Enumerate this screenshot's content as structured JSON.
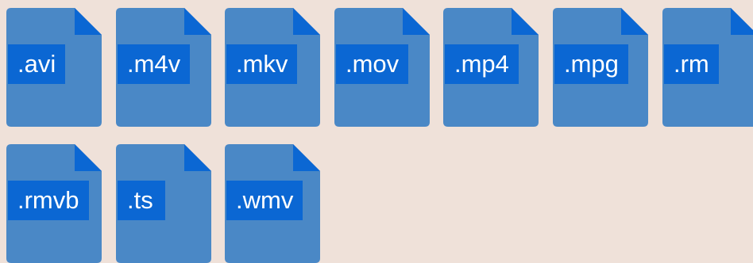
{
  "colors": {
    "background": "#efe1d9",
    "file_body": "#4a88c6",
    "file_fold": "#0b67d3",
    "label_bg": "#0b67d3",
    "label_text": "#ffffff"
  },
  "files": [
    {
      "ext": ".avi",
      "icon": "file-icon"
    },
    {
      "ext": ".m4v",
      "icon": "file-icon"
    },
    {
      "ext": ".mkv",
      "icon": "file-icon"
    },
    {
      "ext": ".mov",
      "icon": "file-icon"
    },
    {
      "ext": ".mp4",
      "icon": "file-icon"
    },
    {
      "ext": ".mpg",
      "icon": "file-icon"
    },
    {
      "ext": ".rm",
      "icon": "file-icon"
    },
    {
      "ext": ".rmvb",
      "icon": "file-icon"
    },
    {
      "ext": ".ts",
      "icon": "file-icon"
    },
    {
      "ext": ".wmv",
      "icon": "file-icon"
    }
  ]
}
